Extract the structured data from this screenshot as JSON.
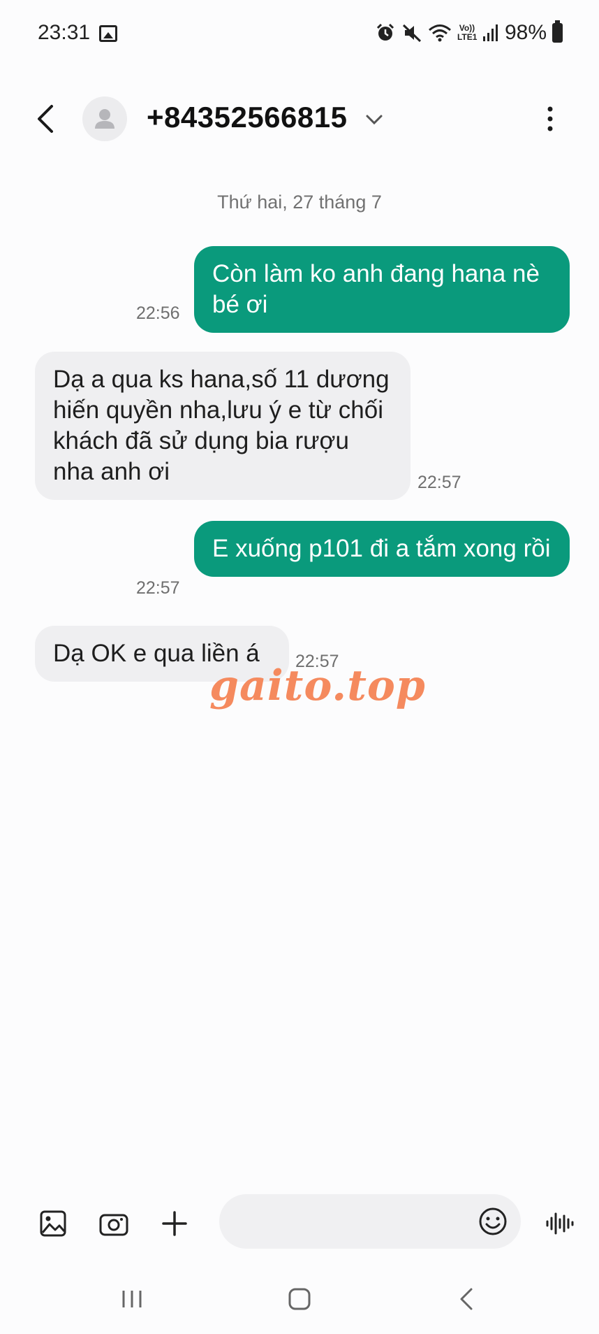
{
  "status_bar": {
    "time": "23:31",
    "gallery_icon": "image-icon",
    "alarm_icon": "alarm-icon",
    "mute_icon": "mute-icon",
    "wifi_icon": "wifi-icon",
    "volte_label": "Vo)) LTE1",
    "signal_icon": "signal-icon",
    "battery": "98%"
  },
  "header": {
    "back_icon": "chevron-left-icon",
    "avatar_icon": "person-icon",
    "title": "+84352566815",
    "expand_icon": "chevron-down-icon",
    "more_icon": "more-vertical-icon"
  },
  "conversation": {
    "date": "Thứ hai, 27 tháng 7",
    "messages": [
      {
        "direction": "outgoing",
        "text": "Còn làm ko anh đang hana nè bé ơi",
        "time": "22:56"
      },
      {
        "direction": "incoming",
        "text": "Dạ a qua ks hana,số 11 dương hiến quyền nha,lưu ý e từ chối khách đã sử dụng bia rượu nha anh ơi",
        "time": "22:57"
      },
      {
        "direction": "outgoing",
        "text": "E xuống p101 đi a tắm xong rồi",
        "time": "22:57"
      },
      {
        "direction": "incoming",
        "text": "Dạ OK e qua liền á",
        "time": "22:57"
      }
    ]
  },
  "watermark": "gaito.top",
  "compose": {
    "gallery_icon": "gallery-icon",
    "camera_icon": "camera-icon",
    "add_icon": "plus-icon",
    "input_value": "",
    "emoji_icon": "emoji-icon",
    "voice_icon": "voice-wave-icon"
  },
  "colors": {
    "outgoing_bubble": "#0a9a7c",
    "incoming_bubble": "#efeff1",
    "background": "#fcfcfd",
    "watermark": "#f58a5e"
  },
  "navbar": {
    "recents_icon": "recents-icon",
    "home_icon": "home-icon",
    "back_icon": "back-icon"
  }
}
